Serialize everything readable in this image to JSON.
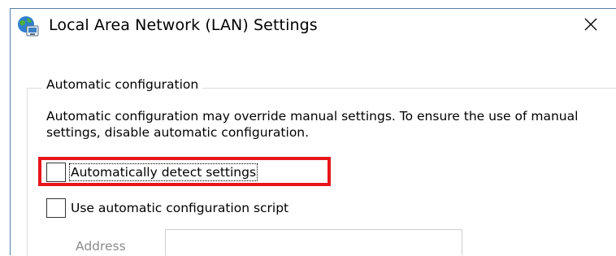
{
  "window": {
    "title": "Local Area Network (LAN) Settings",
    "close_glyph": "✕"
  },
  "automatic_configuration": {
    "group_title": "Automatic configuration",
    "description": "Automatic configuration may override manual settings.  To ensure the use of manual settings, disable automatic configuration.",
    "auto_detect": {
      "label": "Automatically detect settings",
      "checked": false
    },
    "config_script": {
      "label": "Use automatic configuration script",
      "checked": false
    },
    "address": {
      "label": "Address",
      "value": ""
    }
  },
  "colors": {
    "highlight": "#e8161b",
    "window_border": "#5a7fa8",
    "disabled_text": "#8c8c8c"
  },
  "icons": {
    "window_icon": "globe-network-icon"
  }
}
